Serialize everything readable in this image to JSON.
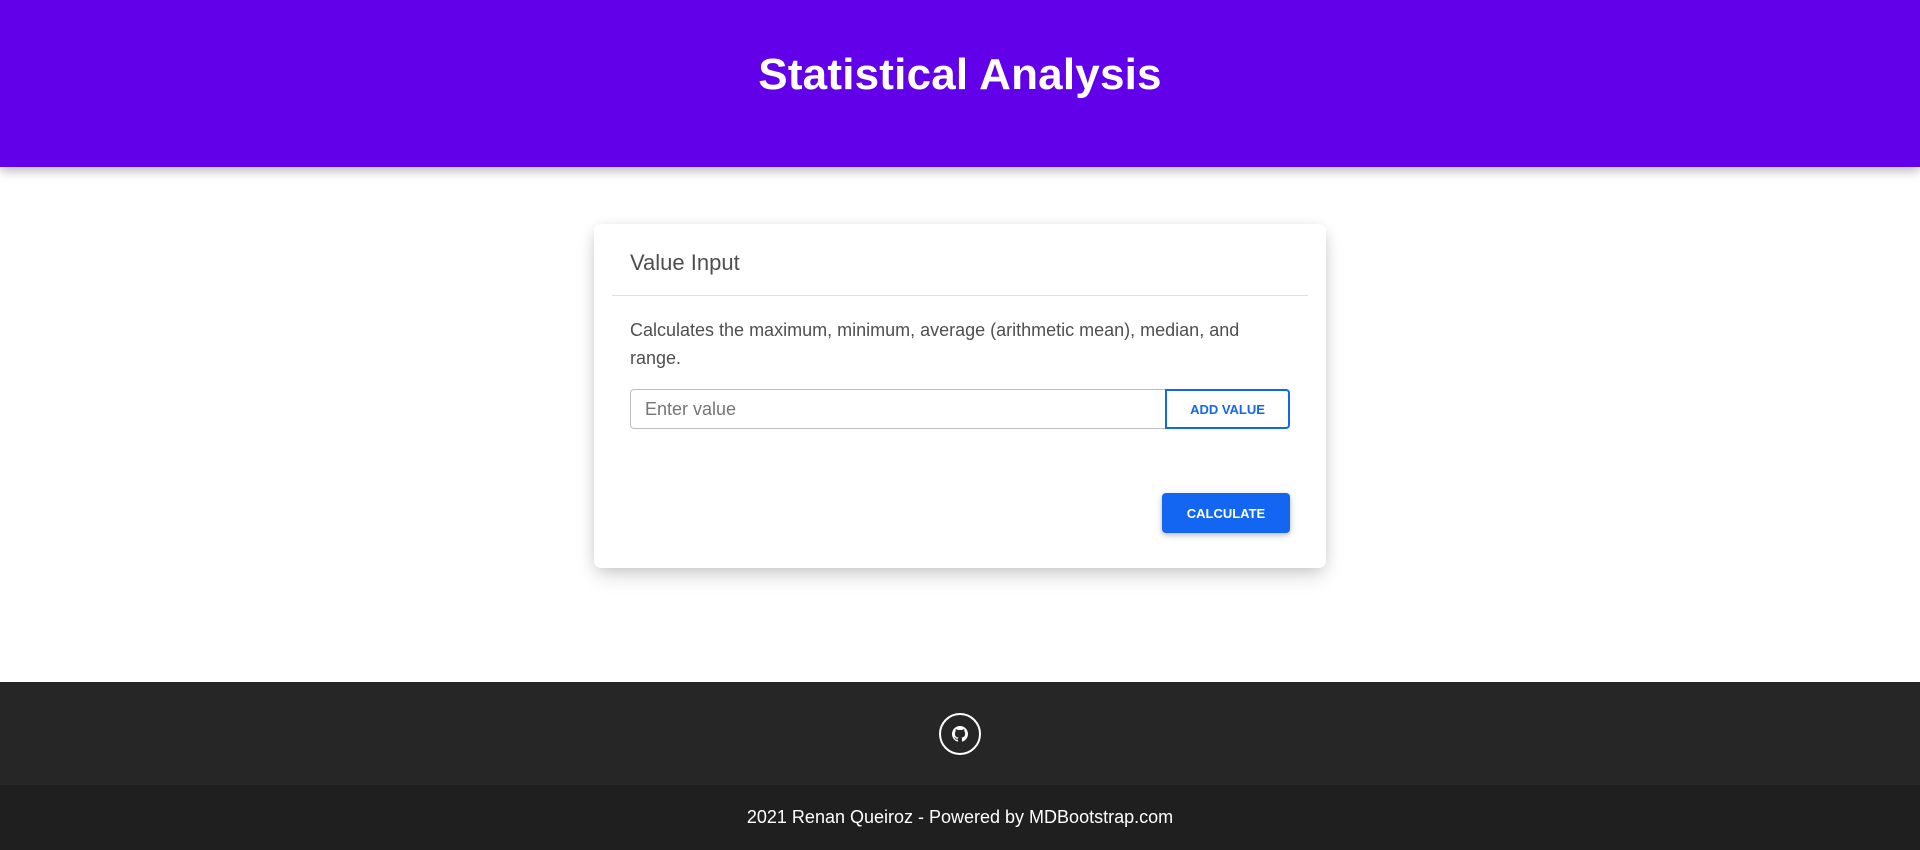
{
  "header": {
    "title": "Statistical Analysis"
  },
  "card": {
    "title": "Value Input",
    "description": "Calculates the maximum, minimum, average (arithmetic mean), median, and range.",
    "input": {
      "value": "",
      "placeholder": "Enter value"
    },
    "add_button_label": "ADD VALUE",
    "calculate_button_label": "CALCULATE"
  },
  "footer": {
    "social_icon": "github-icon",
    "copyright": "2021 Renan Queiroz - Powered by MDBootstrap.com"
  },
  "colors": {
    "header_bg": "#6200ea",
    "primary": "#1266f1",
    "footer_bg": "#262626",
    "footer_copy_bg": "#1f1f1f"
  }
}
